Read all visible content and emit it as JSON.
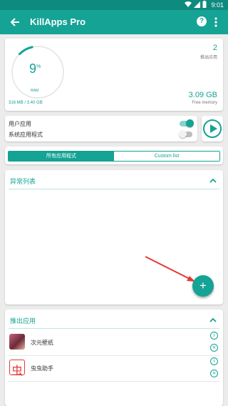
{
  "status_bar": {
    "time": "9:01"
  },
  "app_bar": {
    "title": "KillApps Pro",
    "help_label": "?"
  },
  "memory": {
    "percent": "9",
    "percent_unit": "%",
    "gauge_label": "RAM",
    "gauge_fraction": 0.09,
    "used_total": "316 MB / 3.40 GB",
    "pushed_count": "2",
    "pushed_label": "推出应用",
    "free_value": "3.09 GB",
    "free_label": "Free memory"
  },
  "toggles": [
    {
      "label": "用户应用",
      "on": true
    },
    {
      "label": "系统应用程式",
      "on": false
    }
  ],
  "tabs": [
    {
      "label": "所有应用程式",
      "active": true
    },
    {
      "label": "Custom list",
      "active": false
    }
  ],
  "abnormal": {
    "title": "异常列表"
  },
  "fab_label": "+",
  "pushed_section": {
    "title": "推出应用",
    "apps": [
      {
        "name": "次元壁纸"
      },
      {
        "name": "虫虫助手",
        "icon_char": "虫"
      }
    ]
  },
  "colors": {
    "accent": "#14a394",
    "accent_dark": "#0f8a7e",
    "arrow": "#e53935"
  }
}
